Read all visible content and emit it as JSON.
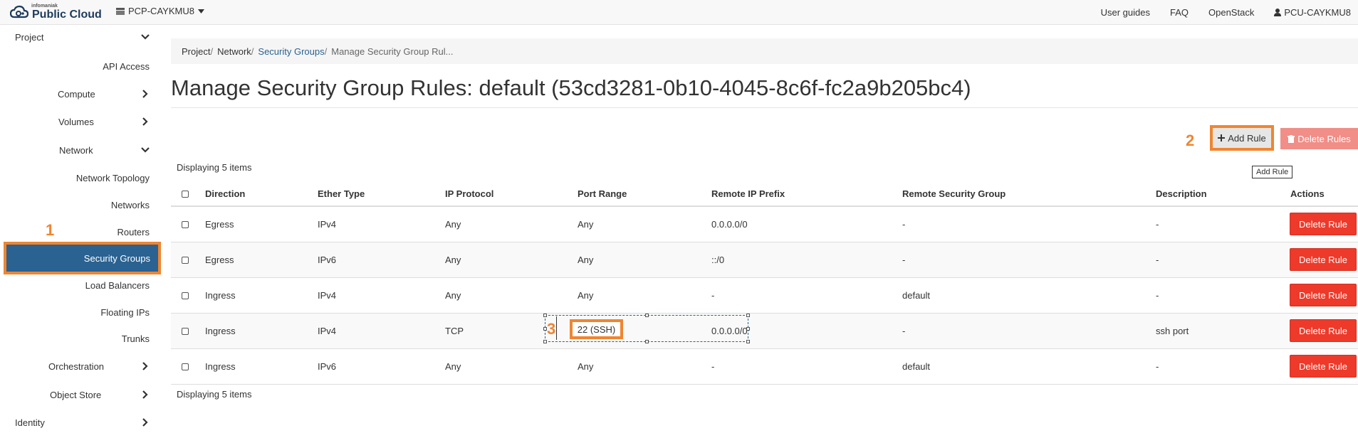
{
  "topbar": {
    "logo_small": "infomaniak",
    "logo_main": "Public Cloud",
    "project": "PCP-CAYKMU8",
    "links": [
      "User guides",
      "FAQ",
      "OpenStack"
    ],
    "user": "PCU-CAYKMU8"
  },
  "sidebar": {
    "items": [
      {
        "label": "Project",
        "chevron": "down"
      },
      {
        "label": "API Access"
      },
      {
        "label": "Compute",
        "chevron": "right"
      },
      {
        "label": "Volumes",
        "chevron": "right"
      },
      {
        "label": "Network",
        "chevron": "down"
      },
      {
        "label": "Network Topology"
      },
      {
        "label": "Networks"
      },
      {
        "label": "Routers"
      },
      {
        "label": "Security Groups",
        "active": true
      },
      {
        "label": "Load Balancers"
      },
      {
        "label": "Floating IPs"
      },
      {
        "label": "Trunks"
      },
      {
        "label": "Orchestration",
        "chevron": "right"
      },
      {
        "label": "Object Store",
        "chevron": "right"
      },
      {
        "label": "Identity",
        "chevron": "right"
      }
    ]
  },
  "breadcrumb": {
    "project": "Project",
    "network": "Network",
    "security_groups": "Security Groups",
    "current": "Manage Security Group Rul..."
  },
  "page_title": "Manage Security Group Rules: default (53cd3281-0b10-4045-8c6f-fc2a9b205bc4)",
  "toolbar": {
    "add_rule": "Add Rule",
    "delete_rules": "Delete Rules",
    "tooltip": "Add Rule"
  },
  "annotations": {
    "one": "1",
    "two": "2",
    "three": "3"
  },
  "count_label": "Displaying 5 items",
  "table": {
    "headers": [
      "Direction",
      "Ether Type",
      "IP Protocol",
      "Port Range",
      "Remote IP Prefix",
      "Remote Security Group",
      "Description",
      "Actions"
    ],
    "rows": [
      {
        "direction": "Egress",
        "ether": "IPv4",
        "protocol": "Any",
        "port": "Any",
        "prefix": "0.0.0.0/0",
        "group": "-",
        "description": "-",
        "action": "Delete Rule"
      },
      {
        "direction": "Egress",
        "ether": "IPv6",
        "protocol": "Any",
        "port": "Any",
        "prefix": "::/0",
        "group": "-",
        "description": "-",
        "action": "Delete Rule"
      },
      {
        "direction": "Ingress",
        "ether": "IPv4",
        "protocol": "Any",
        "port": "Any",
        "prefix": "-",
        "group": "default",
        "description": "-",
        "action": "Delete Rule"
      },
      {
        "direction": "Ingress",
        "ether": "IPv4",
        "protocol": "TCP",
        "port": "22 (SSH)",
        "prefix": "0.0.0.0/0",
        "group": "-",
        "description": "ssh port",
        "action": "Delete Rule"
      },
      {
        "direction": "Ingress",
        "ether": "IPv6",
        "protocol": "Any",
        "port": "Any",
        "prefix": "-",
        "group": "default",
        "description": "-",
        "action": "Delete Rule"
      }
    ]
  },
  "colors": {
    "accent": "#2a6291",
    "annotation": "#f08530",
    "danger": "#ee3a2a"
  }
}
